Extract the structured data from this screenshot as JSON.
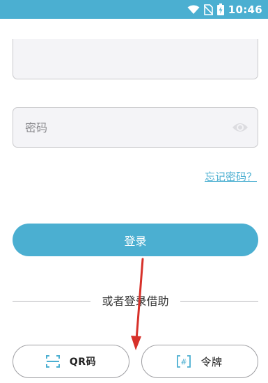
{
  "status_bar": {
    "time": "10:46",
    "icons": [
      "wifi-icon",
      "no-sim-icon",
      "battery-charging-icon"
    ]
  },
  "form": {
    "username": {
      "value": ""
    },
    "password": {
      "placeholder": "密码",
      "value": "",
      "toggle_icon": "eye-icon"
    },
    "forgot_password": "忘记密码？",
    "login_label": "登录"
  },
  "alternatives": {
    "divider_text": "或者登录借助",
    "qr_button": {
      "label": "QR码",
      "icon": "qr-scan-icon"
    },
    "token_button": {
      "label": "令牌",
      "icon": "token-hash-icon"
    }
  },
  "colors": {
    "accent": "#4bafd1",
    "annotation_arrow": "#d7312a"
  }
}
